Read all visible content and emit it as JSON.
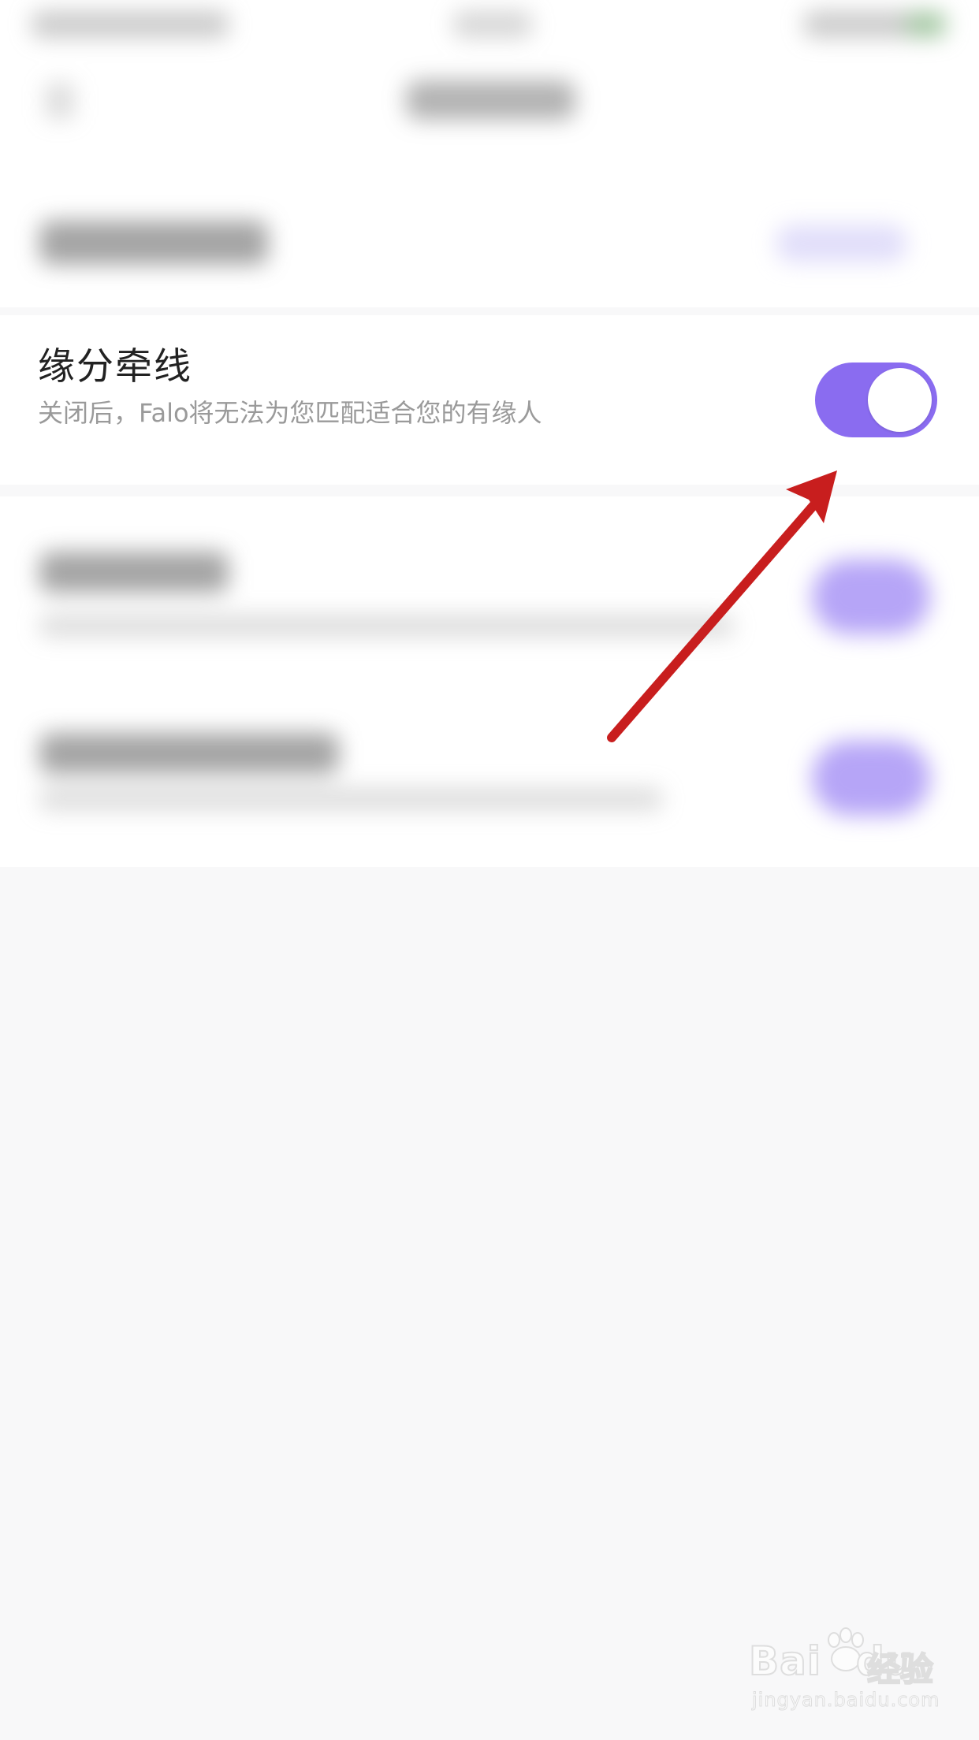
{
  "setting": {
    "title": "缘分牵线",
    "description": "关闭后，Falo将无法为您匹配适合您的有缘人",
    "toggle_on": true,
    "toggle_color": "#8a6cf0"
  },
  "annotation": {
    "arrow_color": "#c81e1e"
  },
  "watermark": {
    "brand": "Bai",
    "brand_suffix": "du",
    "brand_cn": "经验",
    "url": "jingyan.baidu.com"
  }
}
